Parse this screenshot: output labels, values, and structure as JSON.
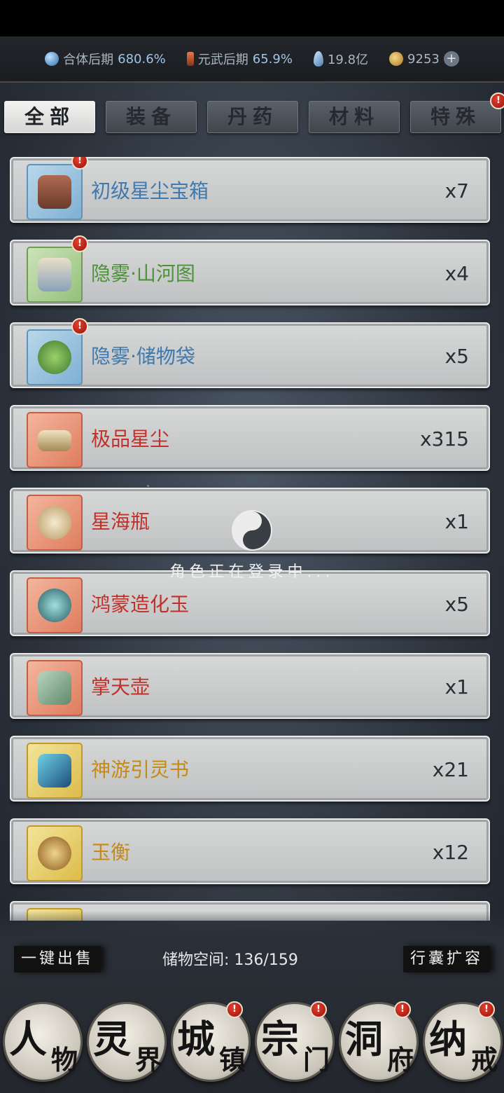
{
  "status": {
    "realm1_label": "合体后期",
    "realm1_value": "680.6%",
    "realm2_label": "元武后期",
    "realm2_value": "65.9%",
    "crystals": "19.8亿",
    "coins": "9253",
    "plus_label": "+"
  },
  "tabs": [
    {
      "label": "全部",
      "active": true,
      "badge": false
    },
    {
      "label": "装备",
      "active": false,
      "badge": false
    },
    {
      "label": "丹药",
      "active": false,
      "badge": false
    },
    {
      "label": "材料",
      "active": false,
      "badge": false
    },
    {
      "label": "特殊",
      "active": false,
      "badge": true
    }
  ],
  "items": [
    {
      "name": "初级星尘宝箱",
      "qty": "x7",
      "rarity": "blue",
      "badge": true
    },
    {
      "name": "隐雾·山河图",
      "qty": "x4",
      "rarity": "green",
      "badge": true
    },
    {
      "name": "隐雾·储物袋",
      "qty": "x5",
      "rarity": "blue",
      "badge": true
    },
    {
      "name": "极品星尘",
      "qty": "x315",
      "rarity": "red",
      "badge": false
    },
    {
      "name": "星海瓶",
      "qty": "x1",
      "rarity": "red",
      "badge": false
    },
    {
      "name": "鸿蒙造化玉",
      "qty": "x5",
      "rarity": "red",
      "badge": false
    },
    {
      "name": "掌天壶",
      "qty": "x1",
      "rarity": "red",
      "badge": false
    },
    {
      "name": "神游引灵书",
      "qty": "x21",
      "rarity": "gold",
      "badge": false
    },
    {
      "name": "玉衡",
      "qty": "x12",
      "rarity": "gold",
      "badge": false
    }
  ],
  "badge_glyph": "!",
  "loading": {
    "text": "角色正在登录中..."
  },
  "bottom": {
    "sell_all_label": "一键出售",
    "storage_label": "储物空间:",
    "storage_value": "136/159",
    "expand_label": "行囊扩容"
  },
  "nav": [
    {
      "big": "人",
      "small": "物",
      "badge": false
    },
    {
      "big": "灵",
      "small": "界",
      "badge": false
    },
    {
      "big": "城",
      "small": "镇",
      "badge": true
    },
    {
      "big": "宗",
      "small": "门",
      "badge": true
    },
    {
      "big": "洞",
      "small": "府",
      "badge": true
    },
    {
      "big": "纳",
      "small": "戒",
      "badge": true
    }
  ],
  "colors": {
    "blue": "#3f79ad",
    "green": "#4d9239",
    "red": "#c2302a",
    "gold": "#c48a14",
    "badge": "#d8321f"
  }
}
